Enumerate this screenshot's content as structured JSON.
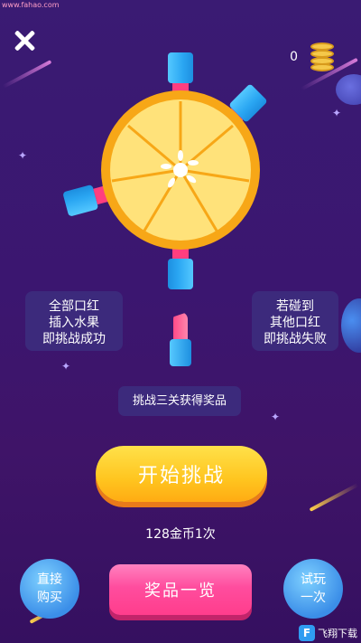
{
  "watermark": "www.fahao.com",
  "coins": {
    "count": "0",
    "icon": "coin-stack-icon"
  },
  "close_icon": "close-icon",
  "left_rule": [
    "全部口红",
    "插入水果",
    "即挑战成功"
  ],
  "right_rule": [
    "若碰到",
    "其他口红",
    "即挑战失败"
  ],
  "challenge_tag": "挑战三关获得奖品",
  "start_button": "开始挑战",
  "cost_text": "128金币1次",
  "direct_buy": [
    "直接",
    "购买"
  ],
  "prize_list": "奖品一览",
  "try_once": [
    "试玩",
    "一次"
  ],
  "logo": {
    "mark": "F",
    "text": "飞翔下载"
  },
  "colors": {
    "background": "#3b1670",
    "lemon_rind": "#f7a717",
    "lemon_flesh": "#ffe27a",
    "lipstick_blue": "#2aa6f2",
    "lipstick_pink": "#ff3e7f",
    "start_button": "#ffc51f",
    "prize_button": "#ff4d9e"
  }
}
